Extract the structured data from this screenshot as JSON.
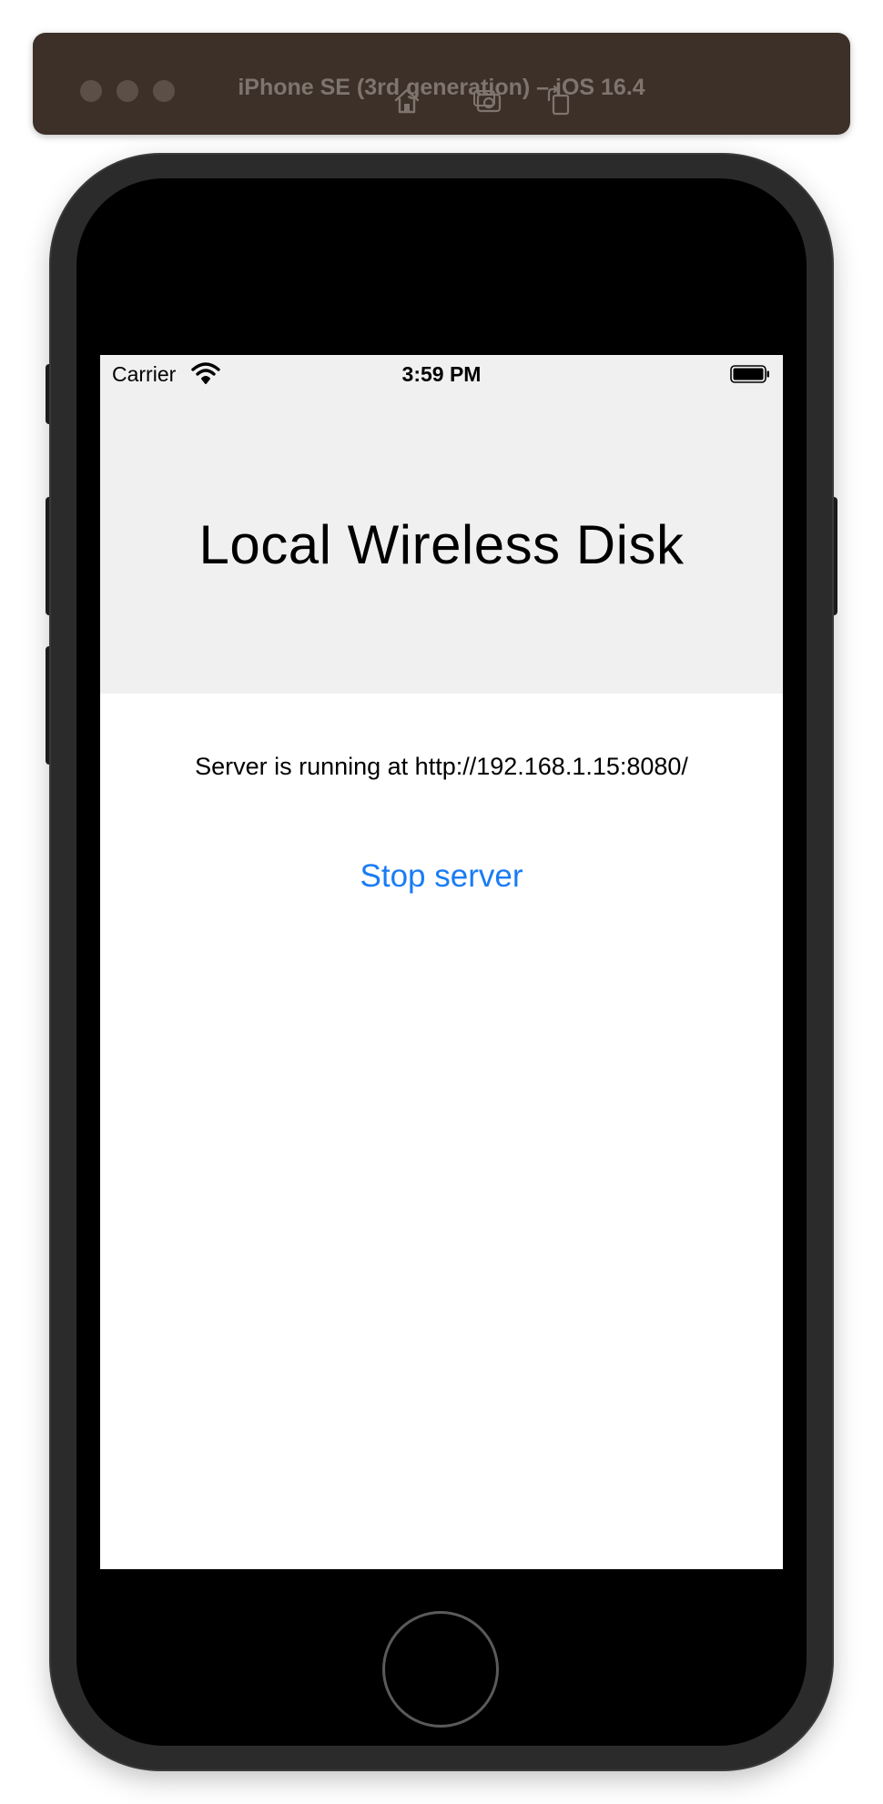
{
  "simulator": {
    "title": "iPhone SE (3rd generation) – iOS 16.4",
    "toolbar_icons": [
      "home-icon",
      "screenshot-icon",
      "rotate-icon"
    ]
  },
  "status_bar": {
    "carrier": "Carrier",
    "time": "3:59 PM",
    "icons": [
      "wifi-icon",
      "battery-icon"
    ]
  },
  "app": {
    "title": "Local Wireless Disk",
    "server_status": "Server is running at http://192.168.1.15:8080/",
    "stop_button_label": "Stop server"
  },
  "colors": {
    "accent": "#1a7cf5",
    "header_background": "#f0f0f0",
    "titlebar_background": "#3d3029"
  }
}
